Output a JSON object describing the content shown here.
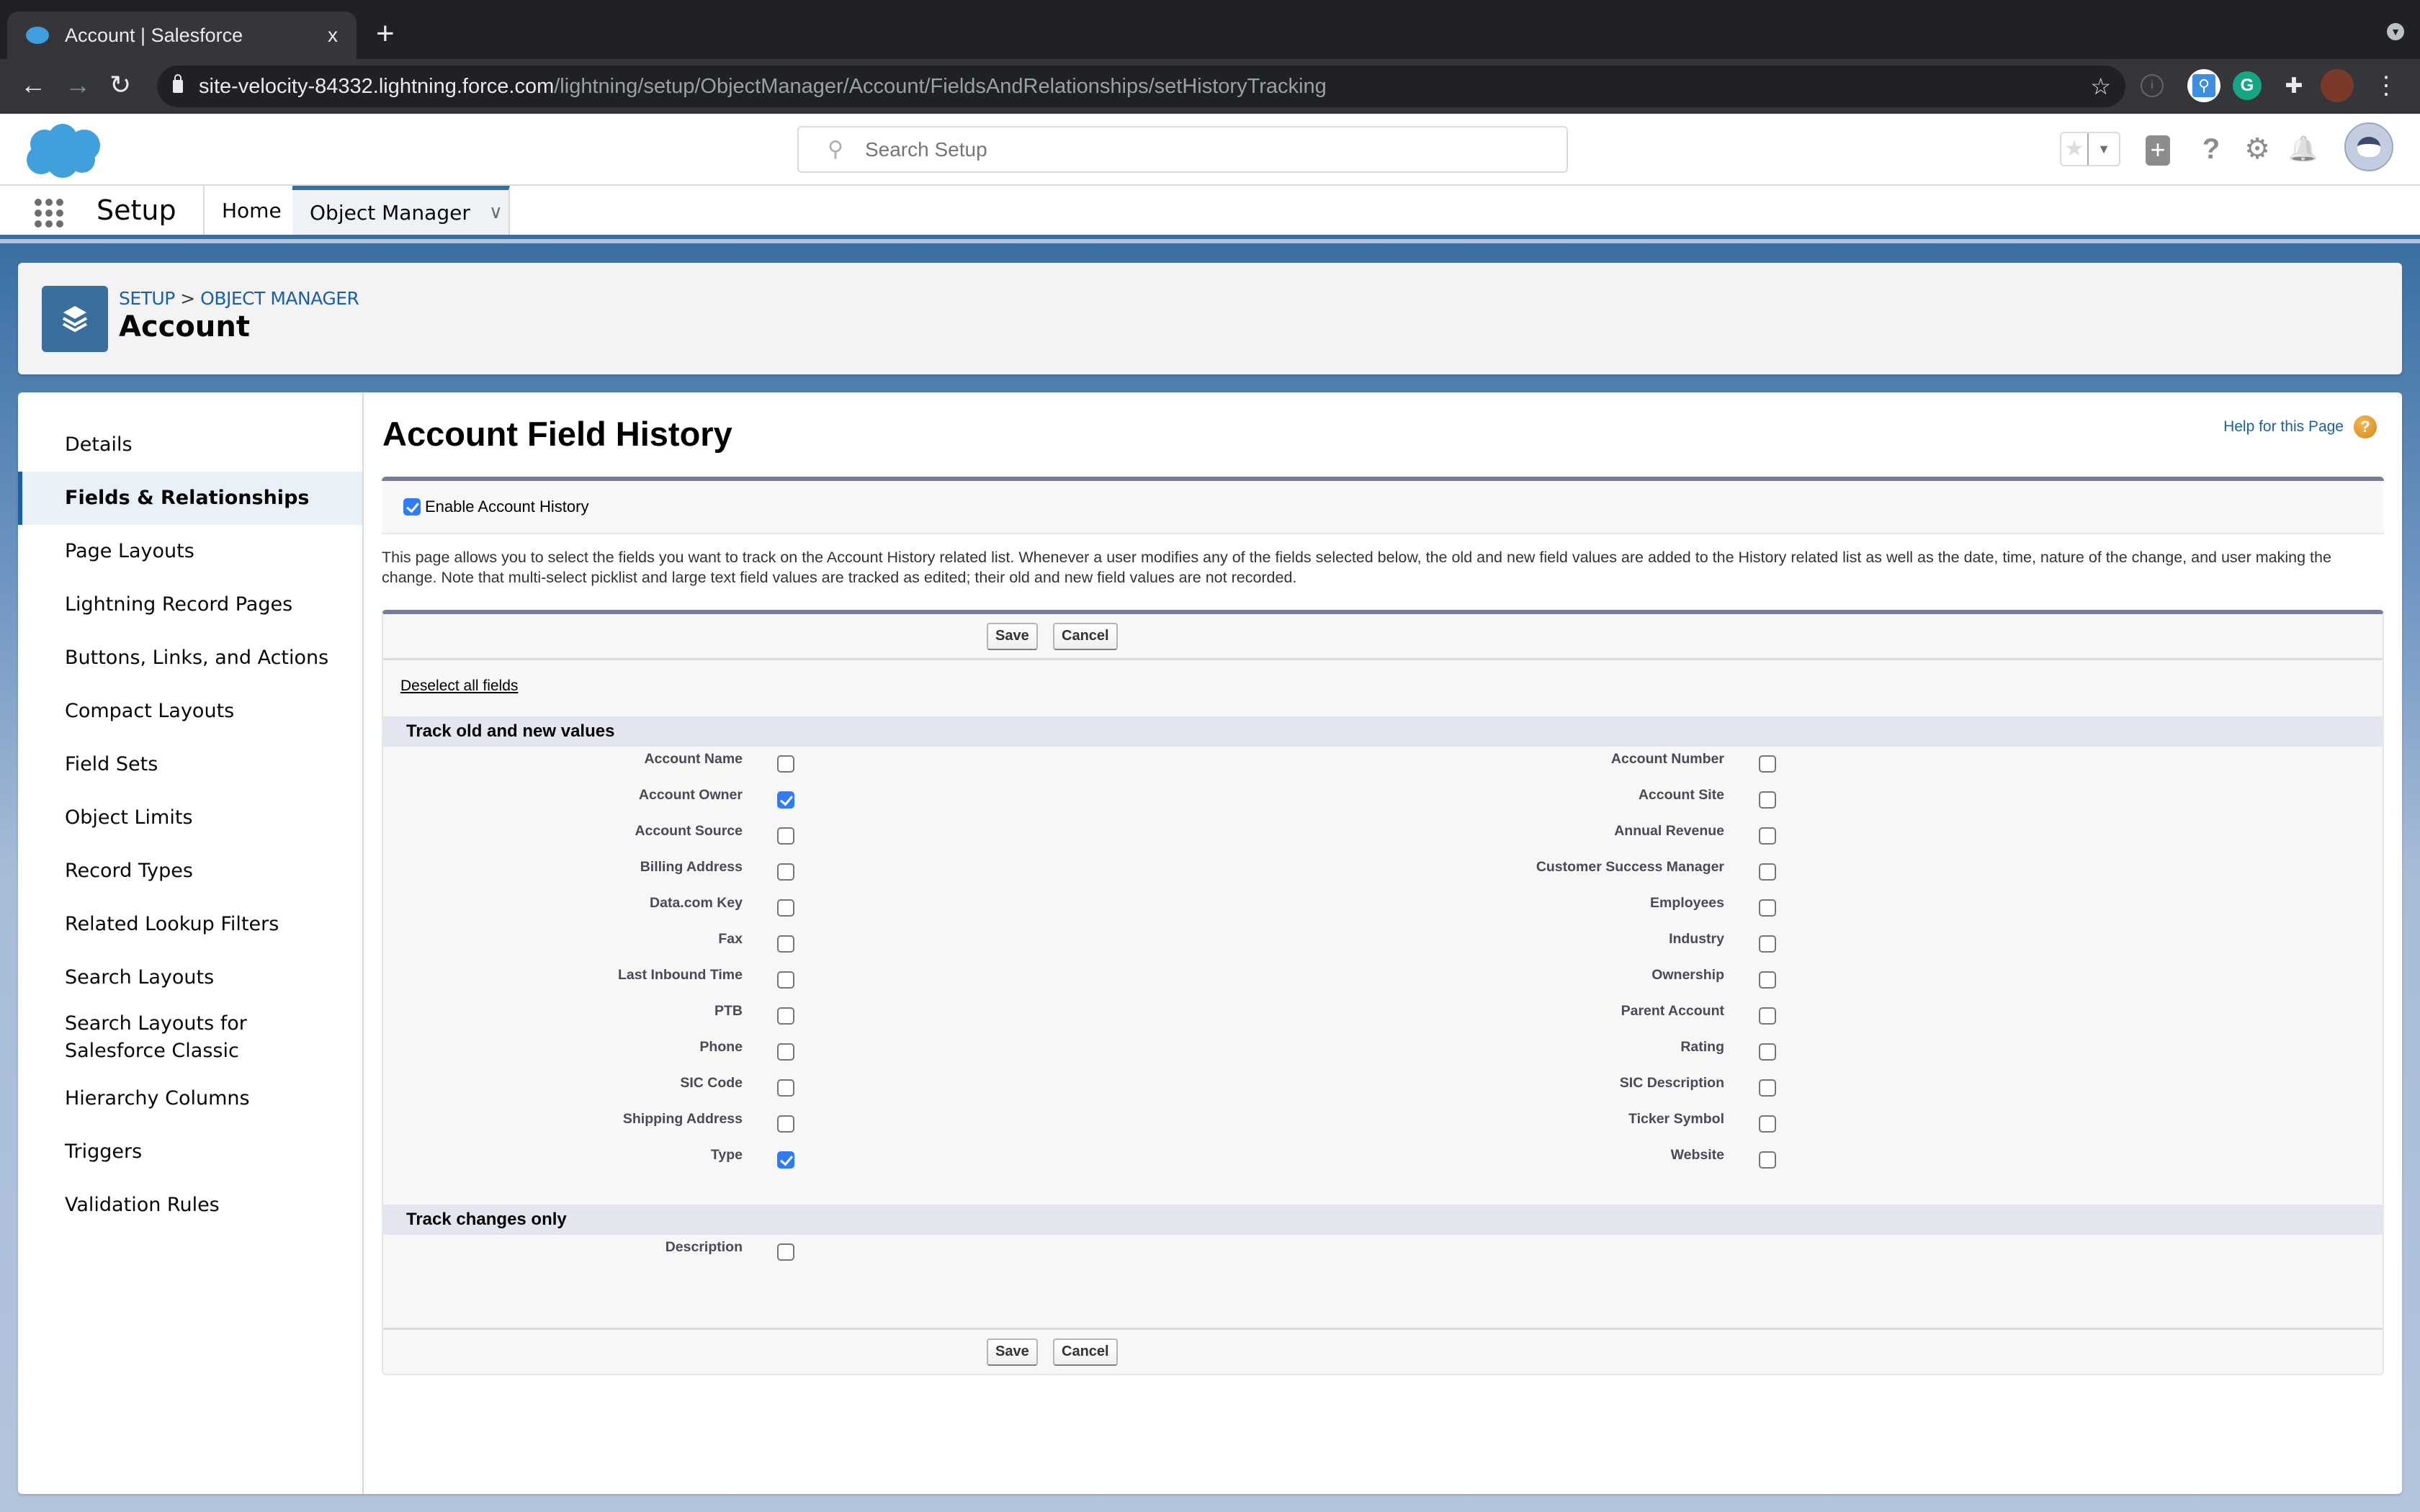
{
  "browser": {
    "tab_title": "Account | Salesforce",
    "tab_close": "x",
    "new_tab": "+",
    "url_host": "site-velocity-84332.lightning.force.com",
    "url_path": "/lightning/setup/ObjectManager/Account/FieldsAndRelationships/setHistoryTracking",
    "nav": {
      "back": "←",
      "forward": "→",
      "reload": "↻"
    },
    "bookmark_icon": "☆",
    "menu_icon": "⋮",
    "extensions_icon": "puzzle"
  },
  "header": {
    "search_placeholder": "Search Setup",
    "help": "?",
    "add": "+",
    "gear": "⚙",
    "bell": "🔔",
    "favorites_star": "★",
    "favorites_dropdown": "▼"
  },
  "navbar": {
    "app_name": "Setup",
    "items": [
      {
        "label": "Home",
        "active": false
      },
      {
        "label": "Object Manager",
        "active": true,
        "chevron": "⌄"
      }
    ]
  },
  "object_header": {
    "breadcrumb": [
      "SETUP",
      "OBJECT MANAGER"
    ],
    "breadcrumb_sep": ">",
    "title": "Account"
  },
  "sidebar": {
    "items": [
      {
        "label": "Details",
        "active": false
      },
      {
        "label": "Fields & Relationships",
        "active": true
      },
      {
        "label": "Page Layouts",
        "active": false
      },
      {
        "label": "Lightning Record Pages",
        "active": false
      },
      {
        "label": "Buttons, Links, and Actions",
        "active": false
      },
      {
        "label": "Compact Layouts",
        "active": false
      },
      {
        "label": "Field Sets",
        "active": false
      },
      {
        "label": "Object Limits",
        "active": false
      },
      {
        "label": "Record Types",
        "active": false
      },
      {
        "label": "Related Lookup Filters",
        "active": false
      },
      {
        "label": "Search Layouts",
        "active": false
      },
      {
        "label": "Search Layouts for Salesforce Classic",
        "active": false
      },
      {
        "label": "Hierarchy Columns",
        "active": false
      },
      {
        "label": "Triggers",
        "active": false
      },
      {
        "label": "Validation Rules",
        "active": false
      }
    ]
  },
  "main": {
    "title": "Account Field History",
    "help_link": "Help for this Page",
    "help_icon": "?",
    "enable_history": {
      "label": "Enable Account History",
      "checked": true
    },
    "description": "This page allows you to select the fields you want to track on the Account History related list. Whenever a user modifies any of the fields selected below, the old and new field values are added to the History related list as well as the date, time, nature of the change, and user making the change. Note that multi-select picklist and large text field values are tracked as edited; their old and new field values are not recorded.",
    "save_label": "Save",
    "cancel_label": "Cancel",
    "deselect_all": "Deselect all fields",
    "sections": [
      {
        "title": "Track old and new values",
        "left_fields": [
          {
            "label": "Account Name",
            "checked": false
          },
          {
            "label": "Account Owner",
            "checked": true
          },
          {
            "label": "Account Source",
            "checked": false
          },
          {
            "label": "Billing Address",
            "checked": false
          },
          {
            "label": "Data.com Key",
            "checked": false
          },
          {
            "label": "Fax",
            "checked": false
          },
          {
            "label": "Last Inbound Time",
            "checked": false
          },
          {
            "label": "PTB",
            "checked": false
          },
          {
            "label": "Phone",
            "checked": false
          },
          {
            "label": "SIC Code",
            "checked": false
          },
          {
            "label": "Shipping Address",
            "checked": false
          },
          {
            "label": "Type",
            "checked": true
          }
        ],
        "right_fields": [
          {
            "label": "Account Number",
            "checked": false
          },
          {
            "label": "Account Site",
            "checked": false
          },
          {
            "label": "Annual Revenue",
            "checked": false
          },
          {
            "label": "Customer Success Manager",
            "checked": false
          },
          {
            "label": "Employees",
            "checked": false
          },
          {
            "label": "Industry",
            "checked": false
          },
          {
            "label": "Ownership",
            "checked": false
          },
          {
            "label": "Parent Account",
            "checked": false
          },
          {
            "label": "Rating",
            "checked": false
          },
          {
            "label": "SIC Description",
            "checked": false
          },
          {
            "label": "Ticker Symbol",
            "checked": false
          },
          {
            "label": "Website",
            "checked": false
          }
        ]
      },
      {
        "title": "Track changes only",
        "left_fields": [
          {
            "label": "Description",
            "checked": false
          }
        ],
        "right_fields": []
      }
    ]
  },
  "colors": {
    "brand_blue": "#3a6e9c",
    "link_blue": "#1b5fa8",
    "checkbox_checked": "#2f7cf6",
    "help_orange": "#e69a2e",
    "salesforce_cloud": "#3f9fdc"
  }
}
